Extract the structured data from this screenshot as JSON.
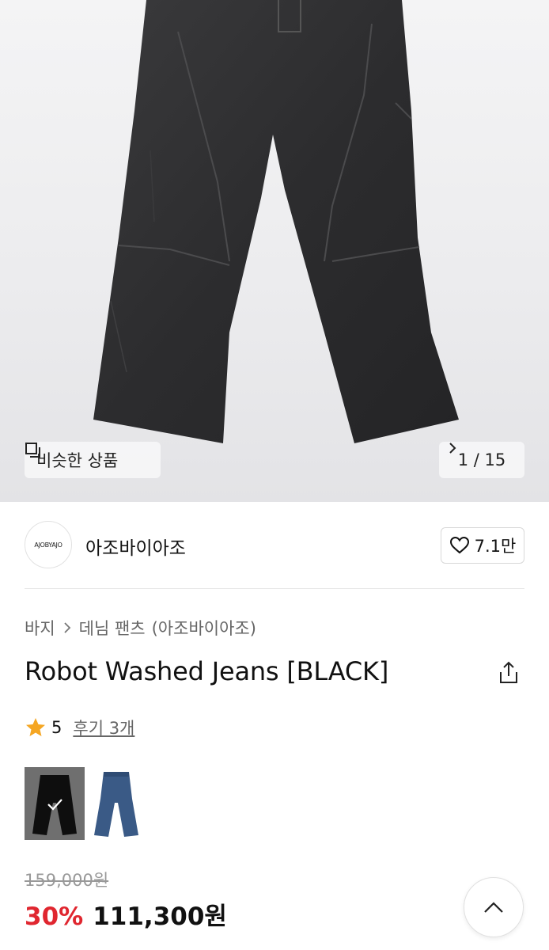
{
  "gallery": {
    "similar_label": "비슷한 상품",
    "counter": "1 / 15"
  },
  "store": {
    "logo_text": "AJOBYAJO",
    "name": "아조바이아조",
    "likes": "7.1만"
  },
  "breadcrumb": {
    "category": "바지",
    "subcategory": "데님 팬츠",
    "brand": "(아조바이아조)"
  },
  "product": {
    "title": "Robot Washed Jeans [BLACK]",
    "rating": "5",
    "review_label": "후기 3개"
  },
  "variants": [
    {
      "color_name": "black",
      "selected": true
    },
    {
      "color_name": "blue",
      "selected": false
    }
  ],
  "price": {
    "original": "159,000원",
    "discount": "30%",
    "sale": "111,300원"
  },
  "icons": {
    "similar": "copy-icon",
    "counter": "chevron-right-icon",
    "like": "heart-icon",
    "share": "share-icon",
    "rating": "star-icon",
    "scroll_top": "chevron-up-icon"
  },
  "colors": {
    "discount_red": "#e0262f",
    "star": "#f5a623"
  }
}
